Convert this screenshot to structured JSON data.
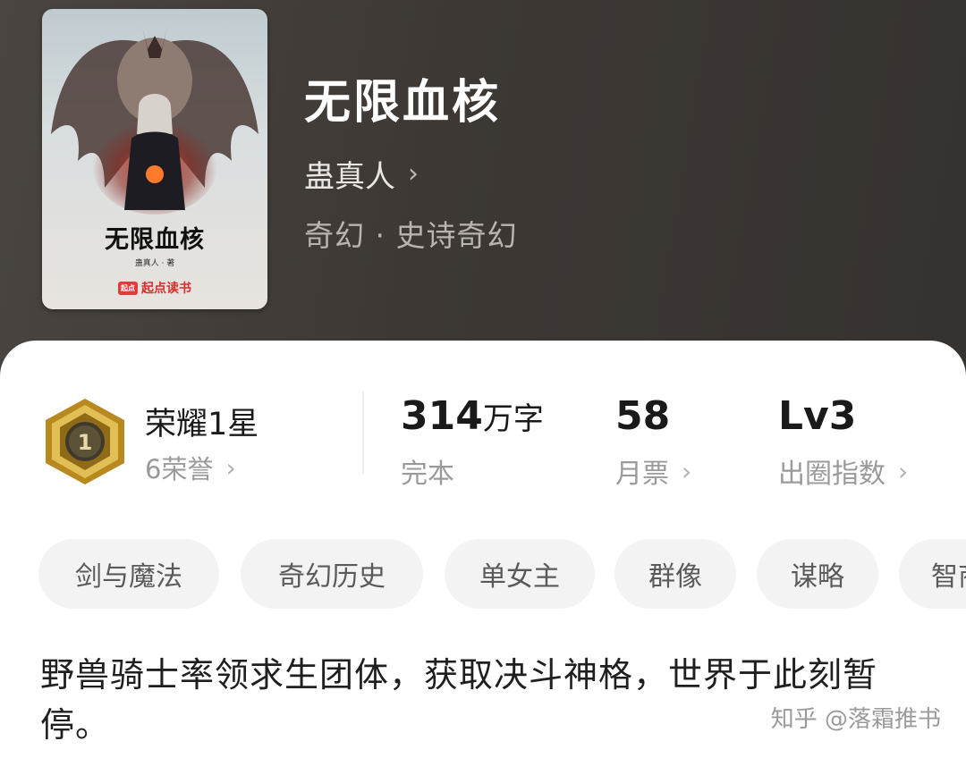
{
  "book": {
    "title": "无限血核",
    "author": "蛊真人",
    "genre": "奇幻 · 史诗奇幻"
  },
  "cover": {
    "title": "无限血核",
    "author": "蛊真人 · 著",
    "brand": "起点读书",
    "brand_logo": "起点"
  },
  "stats": {
    "honor": {
      "title": "荣耀1星",
      "subtitle": "6荣誉",
      "badge_number": "1"
    },
    "words": {
      "value": "314",
      "unit": "万字",
      "label": "完本"
    },
    "monthly_votes": {
      "value": "58",
      "label": "月票"
    },
    "popularity": {
      "value": "Lv3",
      "label": "出圈指数"
    }
  },
  "tags": [
    "剑与魔法",
    "奇幻历史",
    "单女主",
    "群像",
    "谋略",
    "智商"
  ],
  "intro": "野兽骑士率领求生团体，获取决斗神格，世界于此刻暂停。",
  "watermark": "知乎 @落霜推书",
  "icons": {
    "chevron": "chevron-right-icon",
    "badge": "honor-badge-icon"
  },
  "colors": {
    "card_bg": "#ffffff",
    "tag_bg": "#f3f3f3",
    "badge_gold": "#c9a23a",
    "brand_red": "#d92d2d"
  }
}
